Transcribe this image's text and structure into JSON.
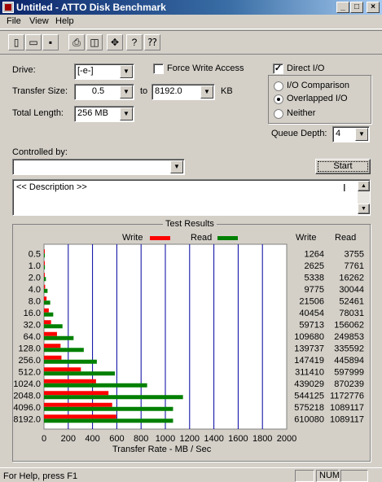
{
  "window": {
    "title": "Untitled - ATTO Disk Benchmark"
  },
  "menu": [
    "File",
    "View",
    "Help"
  ],
  "toolbar_icons": [
    "new-icon",
    "open-icon",
    "save-icon",
    "print-icon",
    "print-preview-icon",
    "move-icon",
    "help-icon",
    "context-help-icon"
  ],
  "form": {
    "drive_label": "Drive:",
    "drive_value": "[-e-]",
    "force_write_label": "Force Write Access",
    "direct_io_label": "Direct I/O",
    "direct_io_checked": true,
    "transfer_size_label": "Transfer Size:",
    "transfer_from": "0.5",
    "to_label": "to",
    "transfer_to": "8192.0",
    "kb_label": "KB",
    "total_length_label": "Total Length:",
    "total_length_value": "256 MB",
    "io_options": [
      {
        "label": "I/O Comparison",
        "selected": false
      },
      {
        "label": "Overlapped I/O",
        "selected": true
      },
      {
        "label": "Neither",
        "selected": false
      }
    ],
    "queue_depth_label": "Queue Depth:",
    "queue_depth_value": "4",
    "controlled_by_label": "Controlled by:",
    "controlled_by_value": "",
    "start_label": "Start",
    "description": "<< Description >>"
  },
  "results": {
    "title": "Test Results",
    "legend_write": "Write",
    "legend_read": "Read",
    "col_write": "Write",
    "col_read": "Read",
    "write_color": "#ff0000",
    "read_color": "#008000",
    "grid_color": "#0000a0"
  },
  "chart_data": {
    "type": "bar",
    "orientation": "horizontal",
    "title": "Test Results",
    "xlabel": "Transfer Rate - MB / Sec",
    "xlim": [
      0,
      2000
    ],
    "xticks": [
      "0",
      "200",
      "400",
      "600",
      "800",
      "1000",
      "1200",
      "1400",
      "1600",
      "1800",
      "2000"
    ],
    "categories": [
      "0.5",
      "1.0",
      "2.0",
      "4.0",
      "8.0",
      "16.0",
      "32.0",
      "64.0",
      "128.0",
      "256.0",
      "512.0",
      "1024.0",
      "2048.0",
      "4096.0",
      "8192.0"
    ],
    "series": [
      {
        "name": "Write",
        "values": [
          1264,
          2625,
          5338,
          9775,
          21506,
          40454,
          59713,
          109680,
          139737,
          147419,
          311410,
          439029,
          544125,
          575218,
          610080
        ]
      },
      {
        "name": "Read",
        "values": [
          3755,
          7761,
          16262,
          30044,
          52461,
          78031,
          156062,
          249853,
          335592,
          445894,
          597999,
          870239,
          1172776,
          1089117,
          1089117
        ]
      }
    ],
    "legend": "top"
  },
  "statusbar": {
    "help": "For Help, press F1",
    "num": "NUM"
  }
}
